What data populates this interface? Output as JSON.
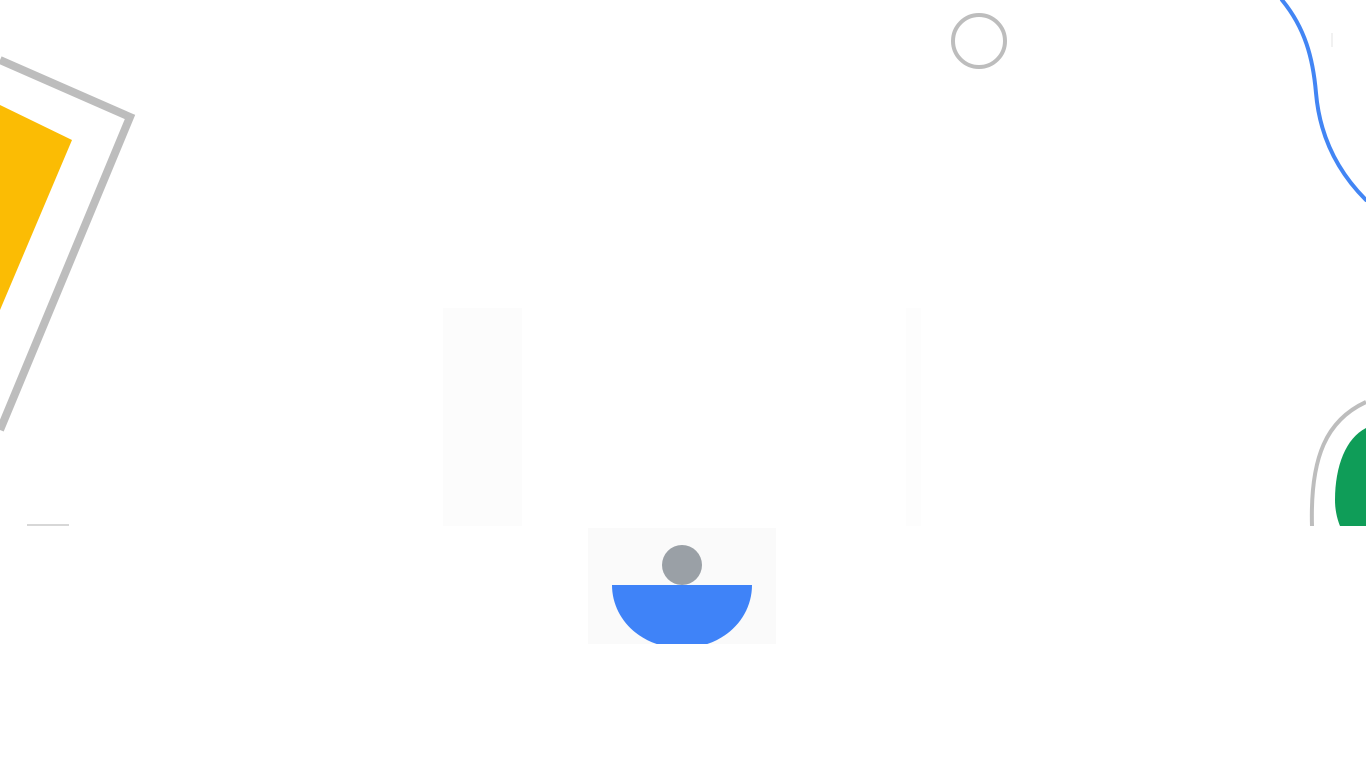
{
  "theme": {
    "background": "#ffffff",
    "yellow": "#fbbc04",
    "blue": "#4285f4",
    "green": "#0f9d58",
    "gray": "#bdbdbd",
    "avatar_head": "#9aa0a6",
    "avatar_body": "#3f83f8"
  },
  "icons": {
    "avatar": "person-avatar-icon"
  }
}
